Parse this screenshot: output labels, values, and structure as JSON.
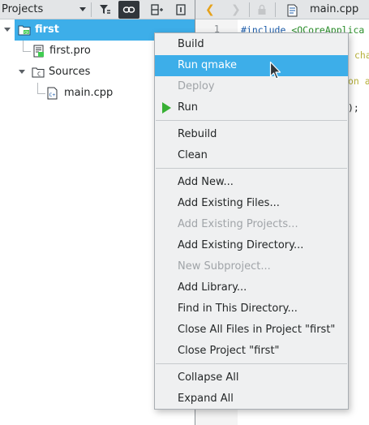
{
  "projects_pane": {
    "selector_label": "Projects",
    "icons": [
      "filter-icon",
      "link-icon",
      "split-icon",
      "close-pane-icon"
    ]
  },
  "tree": {
    "items": [
      {
        "label": "first",
        "icon": "project-folder-icon",
        "selected": true
      },
      {
        "label": "first.pro",
        "icon": "pro-file-icon"
      },
      {
        "label": "Sources",
        "icon": "sources-folder-icon"
      },
      {
        "label": "main.cpp",
        "icon": "cpp-file-icon"
      }
    ]
  },
  "editor": {
    "tab_title": "main.cpp",
    "line_number": "1",
    "code_lines": [
      {
        "prefix": "#include ",
        "rest": "<QCoreApplica"
      },
      {
        "prefix": "",
        "rest": "cha"
      },
      {
        "prefix": "",
        "rest": "on a"
      },
      {
        "prefix": "",
        "rest": ");"
      }
    ]
  },
  "context_menu": {
    "groups": [
      [
        {
          "label": "Build",
          "enabled": true
        },
        {
          "label": "Run qmake",
          "enabled": true,
          "highlighted": true
        },
        {
          "label": "Deploy",
          "enabled": false
        },
        {
          "label": "Run",
          "enabled": true,
          "icon": "run-icon"
        }
      ],
      [
        {
          "label": "Rebuild",
          "enabled": true
        },
        {
          "label": "Clean",
          "enabled": true
        }
      ],
      [
        {
          "label": "Add New...",
          "enabled": true
        },
        {
          "label": "Add Existing Files...",
          "enabled": true
        },
        {
          "label": "Add Existing Projects...",
          "enabled": false
        },
        {
          "label": "Add Existing Directory...",
          "enabled": true
        },
        {
          "label": "New Subproject...",
          "enabled": false
        },
        {
          "label": "Add Library...",
          "enabled": true
        },
        {
          "label": "Find in This Directory...",
          "enabled": true
        },
        {
          "label": "Close All Files in Project \"first\"",
          "enabled": true
        },
        {
          "label": "Close Project \"first\"",
          "enabled": true
        }
      ],
      [
        {
          "label": "Collapse All",
          "enabled": true
        },
        {
          "label": "Expand All",
          "enabled": true
        }
      ]
    ]
  },
  "colors": {
    "selection": "#3daee9",
    "run_icon": "#38b034",
    "code_string": "#2a8e2a",
    "code_keyword": "#b6b03a",
    "code_macro": "#1d5dab"
  }
}
